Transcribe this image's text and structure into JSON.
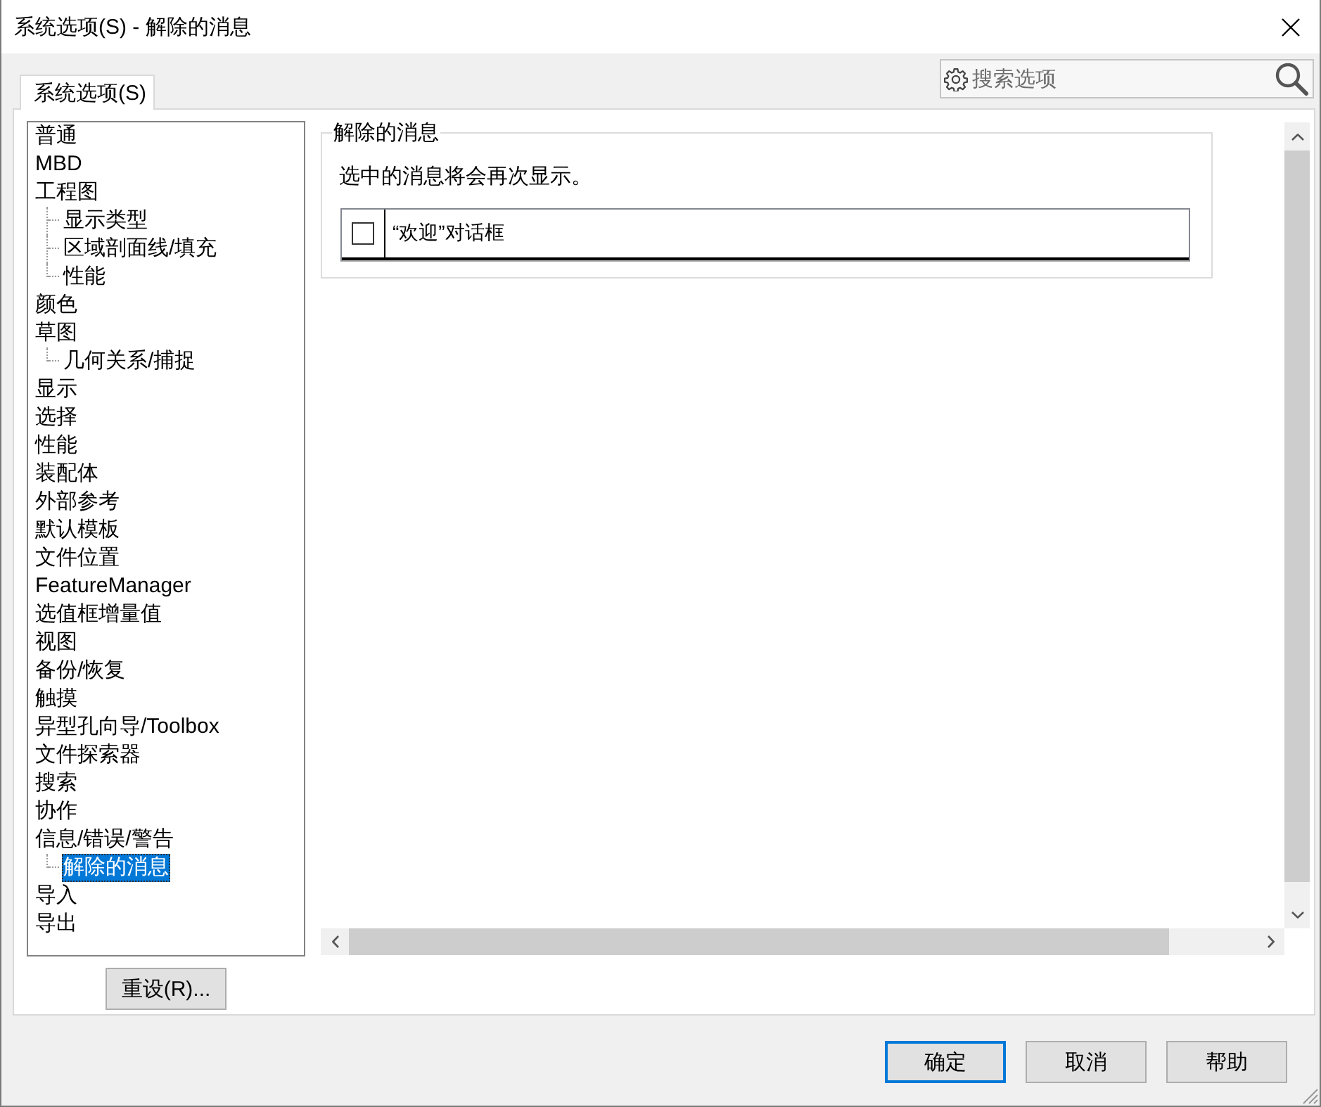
{
  "window": {
    "title": "系统选项(S) - 解除的消息"
  },
  "tabs": [
    {
      "label": "系统选项(S)",
      "selected": true
    }
  ],
  "search": {
    "placeholder": "搜索选项"
  },
  "tree": {
    "items": [
      {
        "label": "普通",
        "selected": false
      },
      {
        "label": "MBD",
        "selected": false
      },
      {
        "label": "工程图",
        "selected": false,
        "children": [
          {
            "label": "显示类型",
            "selected": false
          },
          {
            "label": "区域剖面线/填充",
            "selected": false
          },
          {
            "label": "性能",
            "selected": false
          }
        ]
      },
      {
        "label": "颜色",
        "selected": false
      },
      {
        "label": "草图",
        "selected": false,
        "children": [
          {
            "label": "几何关系/捕捉",
            "selected": false
          }
        ]
      },
      {
        "label": "显示",
        "selected": false
      },
      {
        "label": "选择",
        "selected": false
      },
      {
        "label": "性能",
        "selected": false
      },
      {
        "label": "装配体",
        "selected": false
      },
      {
        "label": "外部参考",
        "selected": false
      },
      {
        "label": "默认模板",
        "selected": false
      },
      {
        "label": "文件位置",
        "selected": false
      },
      {
        "label": "FeatureManager",
        "selected": false
      },
      {
        "label": "选值框增量值",
        "selected": false
      },
      {
        "label": "视图",
        "selected": false
      },
      {
        "label": "备份/恢复",
        "selected": false
      },
      {
        "label": "触摸",
        "selected": false
      },
      {
        "label": "异型孔向导/Toolbox",
        "selected": false
      },
      {
        "label": "文件探索器",
        "selected": false
      },
      {
        "label": "搜索",
        "selected": false
      },
      {
        "label": "协作",
        "selected": false
      },
      {
        "label": "信息/错误/警告",
        "selected": false,
        "children": [
          {
            "label": "解除的消息",
            "selected": true
          }
        ]
      },
      {
        "label": "导入",
        "selected": false
      },
      {
        "label": "导出",
        "selected": false
      }
    ]
  },
  "reset_button": {
    "label": "重设(R)..."
  },
  "panel": {
    "title": "解除的消息",
    "description": "选中的消息将会再次显示。",
    "messages": [
      {
        "label": "“欢迎”对话框",
        "checked": false
      }
    ]
  },
  "buttons": [
    {
      "label": "确定",
      "default": true
    },
    {
      "label": "取消",
      "default": false
    },
    {
      "label": "帮助",
      "default": false
    }
  ]
}
